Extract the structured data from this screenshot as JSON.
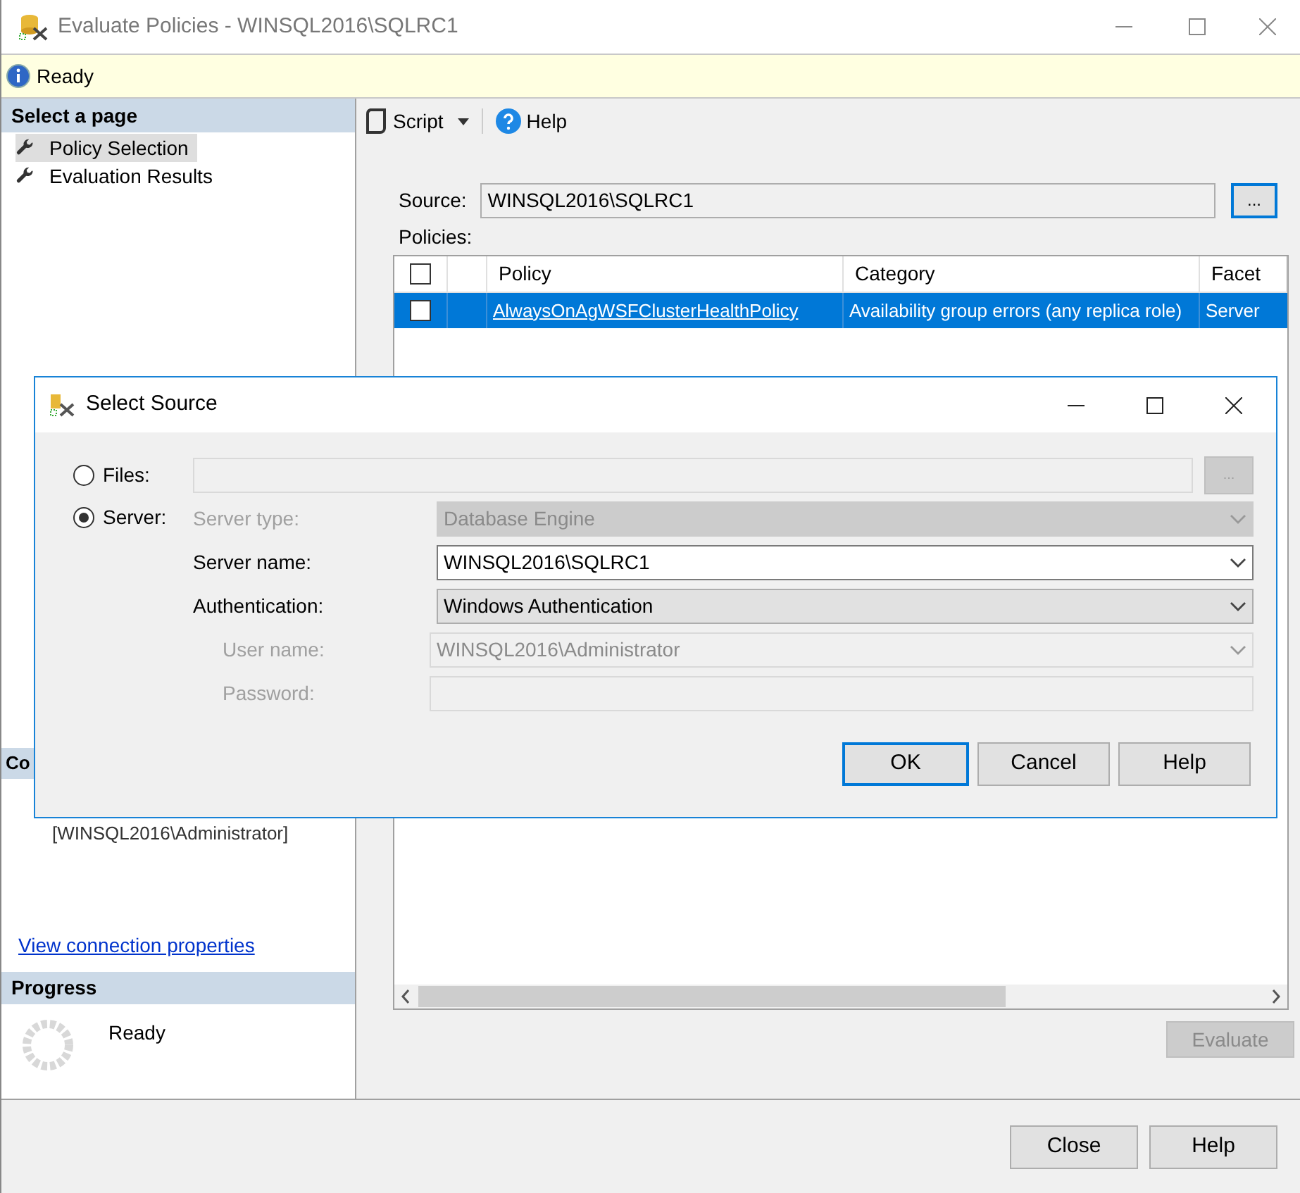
{
  "window": {
    "title": "Evaluate Policies - WINSQL2016\\SQLRC1"
  },
  "info_bar": {
    "text": "Ready"
  },
  "sidebar": {
    "header": "Select a page",
    "items": [
      {
        "label": "Policy Selection",
        "selected": true
      },
      {
        "label": "Evaluation Results",
        "selected": false
      }
    ],
    "connection": {
      "header": "Co",
      "user": "[WINSQL2016\\Administrator]",
      "link": "View connection properties"
    },
    "progress": {
      "header": "Progress",
      "status": "Ready"
    }
  },
  "toolbar": {
    "script": "Script",
    "help": "Help"
  },
  "source": {
    "label": "Source:",
    "value": "WINSQL2016\\SQLRC1",
    "browse": "..."
  },
  "policies": {
    "label": "Policies:",
    "all_checked": false,
    "columns": [
      "Policy",
      "Category",
      "Facet"
    ],
    "rows": [
      {
        "checked": false,
        "selected": true,
        "policy": "AlwaysOnAgWSFClusterHealthPolicy",
        "category": "Availability group errors (any replica role)",
        "facet": "Server"
      }
    ]
  },
  "evaluate_button": {
    "label": "Evaluate",
    "disabled": true
  },
  "buttons": [
    "Close",
    "Help"
  ],
  "dialog": {
    "title": "Select Source",
    "options": [
      {
        "label": "Files:",
        "selected": false
      },
      {
        "label": "Server:",
        "selected": true
      }
    ],
    "files_browse": "...",
    "fields": [
      {
        "label": "Server type:",
        "value": "Database Engine",
        "kind": "combo",
        "disabled": true
      },
      {
        "label": "Server name:",
        "value": "WINSQL2016\\SQLRC1",
        "kind": "editcombo",
        "disabled": false
      },
      {
        "label": "Authentication:",
        "value": "Windows Authentication",
        "kind": "combo",
        "disabled": false,
        "children": [
          {
            "label": "User name:",
            "value": "WINSQL2016\\Administrator",
            "kind": "editcombo",
            "disabled": true
          },
          {
            "label": "Password:",
            "kind": "text",
            "disabled": true
          }
        ]
      }
    ],
    "buttons": [
      {
        "label": "OK",
        "default": true
      },
      {
        "label": "Cancel",
        "default": false
      },
      {
        "label": "Help",
        "default": false
      }
    ]
  }
}
